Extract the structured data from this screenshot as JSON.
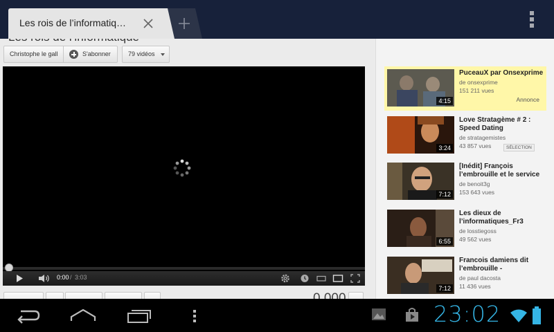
{
  "browser": {
    "tab_title": "Les rois de l’informatiq…",
    "page_title_partial": "Les rois de l’informatique"
  },
  "channel_bar": {
    "channel_name": "Christophe le gall",
    "subscribe_label": "S'abonner",
    "videos_count": "79 vidéos"
  },
  "player": {
    "current_time": "0:00",
    "separator": "/",
    "total_time": "3:03",
    "progress": 0
  },
  "below_player": {
    "views_partial": "0.000"
  },
  "related": [
    {
      "title": "PuceauX par Onsexprime",
      "by": "de onsexprime",
      "views": "151 211 vues",
      "duration": "4:15",
      "badge": "Annonce"
    },
    {
      "title": "Love Stratagème # 2 : Speed Dating",
      "by": "de stratagemistes",
      "views": "43 857 vues",
      "duration": "3:24",
      "badge": "SÉLECTION"
    },
    {
      "title": "[Inédit] François l’embrouille et le service",
      "by": "de benoit3g",
      "views": "153 643 vues",
      "duration": "7:12"
    },
    {
      "title": "Les dieux de l’informatiques_Fr3",
      "by": "de losstiegoss",
      "views": "49 562 vues",
      "duration": "6:55"
    },
    {
      "title": "Francois damiens dit l’embrouille -",
      "by": "de paul dacosta",
      "views": "11 436 vues",
      "duration": "7:12"
    }
  ],
  "status": {
    "clock": "23:02",
    "accent": "#35b5e5"
  }
}
